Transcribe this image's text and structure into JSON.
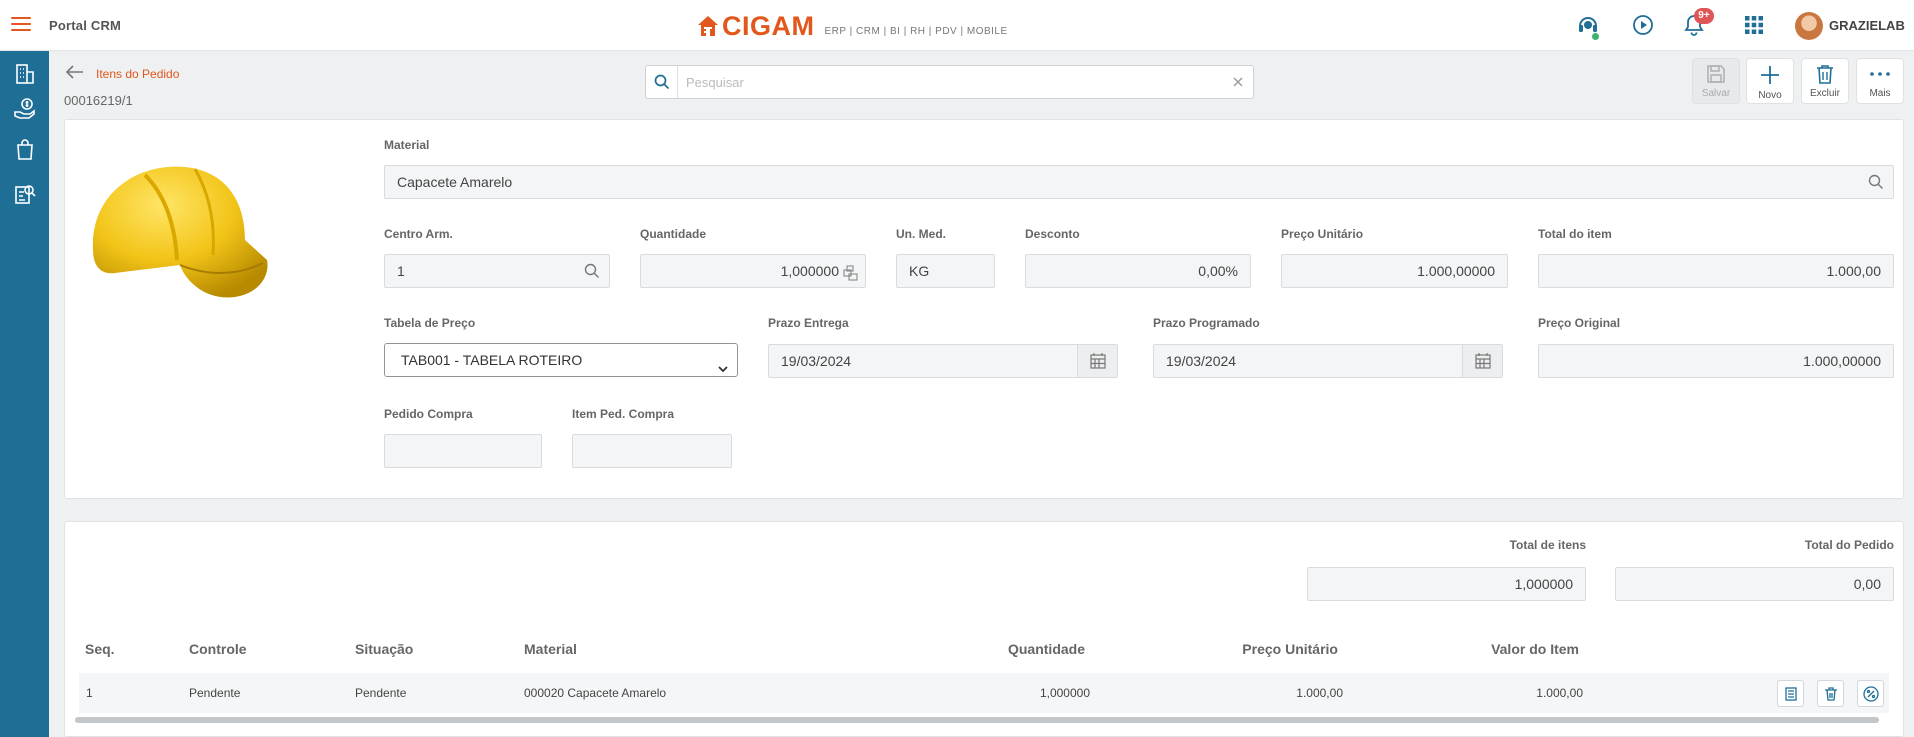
{
  "app": {
    "name": "Portal CRM",
    "brand": "CIGAM",
    "brand_tagline": "ERP | CRM | BI | RH | PDV | MOBILE"
  },
  "topbar": {
    "notification_count": "9+",
    "username": "GRAZIELAB"
  },
  "header": {
    "breadcrumb": "Itens do Pedido",
    "order_number": "00016219/1",
    "search_placeholder": "Pesquisar"
  },
  "toolbar": {
    "save": "Salvar",
    "new": "Novo",
    "delete": "Excluir",
    "more": "Mais"
  },
  "form": {
    "material_label": "Material",
    "material_value": "Capacete Amarelo",
    "warehouse_label": "Centro Arm.",
    "warehouse_value": "1",
    "quantity_label": "Quantidade",
    "quantity_value": "1,000000",
    "unit_label": "Un. Med.",
    "unit_value": "KG",
    "discount_label": "Desconto",
    "discount_value": "0,00%",
    "unit_price_label": "Preço Unitário",
    "unit_price_value": "1.000,00000",
    "item_total_label": "Total do item",
    "item_total_value": "1.000,00",
    "price_table_label": "Tabela de Preço",
    "price_table_value": "TAB001 - TABELA ROTEIRO",
    "delivery_label": "Prazo Entrega",
    "delivery_value": "19/03/2024",
    "scheduled_label": "Prazo Programado",
    "scheduled_value": "19/03/2024",
    "original_price_label": "Preço Original",
    "original_price_value": "1.000,00000",
    "purchase_order_label": "Pedido Compra",
    "purchase_order_value": "",
    "purchase_item_label": "Item Ped. Compra",
    "purchase_item_value": ""
  },
  "totals": {
    "items_label": "Total de itens",
    "items_value": "1,000000",
    "order_label": "Total do Pedido",
    "order_value": "0,00"
  },
  "table": {
    "columns": [
      "Seq.",
      "Controle",
      "Situação",
      "Material",
      "Quantidade",
      "Preço Unitário",
      "Valor do Item"
    ],
    "rows": [
      [
        "1",
        "Pendente",
        "Pendente",
        "000020 Capacete Amarelo",
        "1,000000",
        "1.000,00",
        "1.000,00"
      ]
    ]
  },
  "colors": {
    "accent": "#e2571b",
    "sidebar": "#1f6e96",
    "helmet": "#f2c418"
  }
}
